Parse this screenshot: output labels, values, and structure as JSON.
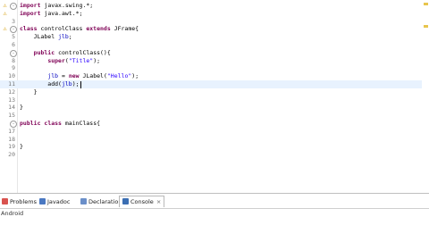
{
  "code_lines": [
    {
      "num": "1",
      "tokens": [
        {
          "t": "import ",
          "c": "kw"
        },
        {
          "t": "javax.swing.*;"
        }
      ],
      "marker": "warning",
      "fold": "-"
    },
    {
      "num": "2",
      "tokens": [
        {
          "t": "import ",
          "c": "kw"
        },
        {
          "t": "java.awt.*;"
        }
      ],
      "marker": "warning"
    },
    {
      "num": "3",
      "tokens": []
    },
    {
      "num": "4",
      "tokens": [
        {
          "t": "class ",
          "c": "kw"
        },
        {
          "t": "controlClass "
        },
        {
          "t": "extends ",
          "c": "kw"
        },
        {
          "t": "JFrame{"
        }
      ],
      "marker": "warning",
      "fold": "-"
    },
    {
      "num": "5",
      "tokens": [
        {
          "t": "    JLabel "
        },
        {
          "t": "jlb",
          "c": "fld"
        },
        {
          "t": ";"
        }
      ]
    },
    {
      "num": "6",
      "tokens": []
    },
    {
      "num": "7",
      "tokens": [
        {
          "t": "    "
        },
        {
          "t": "public ",
          "c": "kw"
        },
        {
          "t": "controlClass(){"
        }
      ],
      "fold": "-"
    },
    {
      "num": "8",
      "tokens": [
        {
          "t": "        "
        },
        {
          "t": "super",
          "c": "kw"
        },
        {
          "t": "("
        },
        {
          "t": "\"Title\"",
          "c": "str"
        },
        {
          "t": ");"
        }
      ]
    },
    {
      "num": "9",
      "tokens": []
    },
    {
      "num": "10",
      "tokens": [
        {
          "t": "        "
        },
        {
          "t": "jlb",
          "c": "fld"
        },
        {
          "t": " = "
        },
        {
          "t": "new ",
          "c": "kw"
        },
        {
          "t": "JLabel("
        },
        {
          "t": "\"Hello\"",
          "c": "str"
        },
        {
          "t": ");"
        }
      ]
    },
    {
      "num": "11",
      "tokens": [
        {
          "t": "        add("
        },
        {
          "t": "jlb",
          "c": "fld"
        },
        {
          "t": ");"
        }
      ],
      "current": true,
      "caret": true
    },
    {
      "num": "12",
      "tokens": [
        {
          "t": "    }"
        }
      ]
    },
    {
      "num": "13",
      "tokens": []
    },
    {
      "num": "14",
      "tokens": [
        {
          "t": "}"
        }
      ]
    },
    {
      "num": "15",
      "tokens": []
    },
    {
      "num": "16",
      "tokens": [
        {
          "t": "public ",
          "c": "kw"
        },
        {
          "t": "class ",
          "c": "kw"
        },
        {
          "t": "mainClass{"
        }
      ],
      "fold": "-"
    },
    {
      "num": "17",
      "tokens": []
    },
    {
      "num": "18",
      "tokens": []
    },
    {
      "num": "19",
      "tokens": [
        {
          "t": "}"
        }
      ]
    },
    {
      "num": "20",
      "tokens": []
    }
  ],
  "bottom_tabs": [
    {
      "label": "Problems",
      "icon_name": "problems-icon",
      "icon_color": "#d9534f",
      "active": false
    },
    {
      "label": "Javadoc",
      "icon_name": "javadoc-icon",
      "icon_color": "#4a78c2",
      "active": false
    },
    {
      "label": "Declaration",
      "icon_name": "declaration-icon",
      "icon_color": "#6b8fc9",
      "active": false
    },
    {
      "label": "Console",
      "icon_name": "console-icon",
      "icon_color": "#3c6fb3",
      "active": true
    }
  ],
  "console_label": "Android",
  "colors": {
    "keyword": "#7f0055",
    "string": "#2a00ff",
    "field": "#0000c0",
    "current_line": "#e8f2fe",
    "warning": "#d49b00"
  }
}
